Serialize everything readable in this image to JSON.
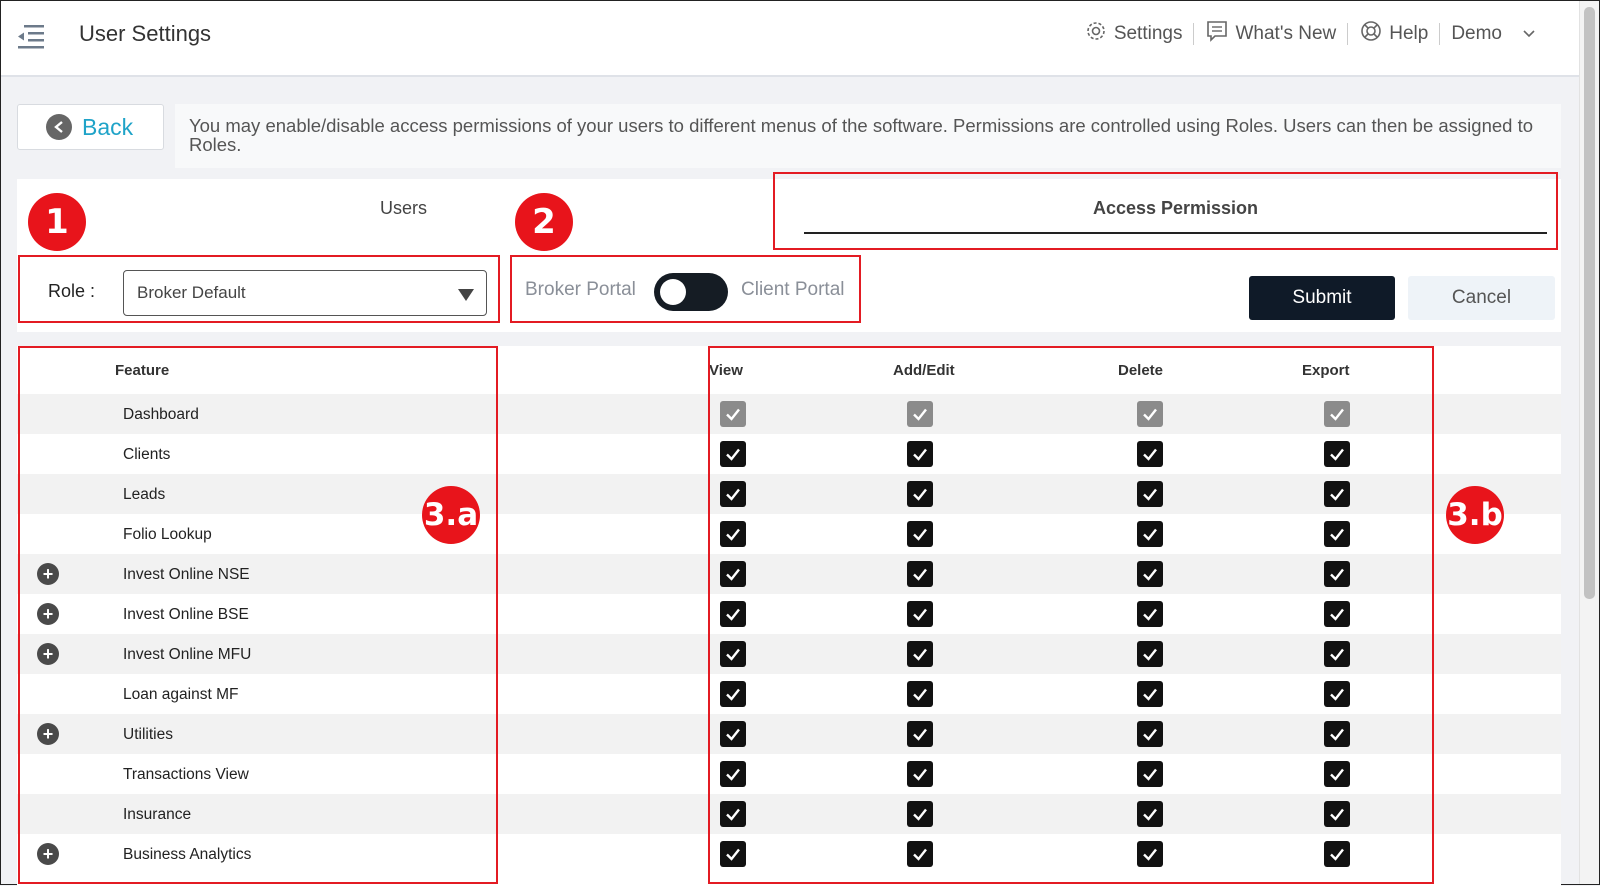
{
  "header": {
    "title": "User Settings",
    "settings_label": "Settings",
    "whats_new_label": "What's New",
    "help_label": "Help",
    "user_label": "Demo"
  },
  "back_label": "Back",
  "info_text": "You may enable/disable access permissions of your users to different menus of the software. Permissions are controlled using Roles. Users can then be assigned to Roles.",
  "tabs": {
    "users": "Users",
    "access": "Access Permission"
  },
  "role": {
    "label": "Role :",
    "value": "Broker Default"
  },
  "portal": {
    "broker": "Broker Portal",
    "client": "Client Portal",
    "client_selected": false
  },
  "buttons": {
    "submit": "Submit",
    "cancel": "Cancel"
  },
  "table": {
    "headers": {
      "feature": "Feature",
      "view": "View",
      "add_edit": "Add/Edit",
      "delete": "Delete",
      "export": "Export"
    },
    "rows": [
      {
        "feature": "Dashboard",
        "expandable": false,
        "disabled": true
      },
      {
        "feature": "Clients",
        "expandable": false,
        "disabled": false
      },
      {
        "feature": "Leads",
        "expandable": false,
        "disabled": false
      },
      {
        "feature": "Folio Lookup",
        "expandable": false,
        "disabled": false
      },
      {
        "feature": "Invest Online NSE",
        "expandable": true,
        "disabled": false
      },
      {
        "feature": "Invest Online BSE",
        "expandable": true,
        "disabled": false
      },
      {
        "feature": "Invest Online MFU",
        "expandable": true,
        "disabled": false
      },
      {
        "feature": "Loan against MF",
        "expandable": false,
        "disabled": false
      },
      {
        "feature": "Utilities",
        "expandable": true,
        "disabled": false
      },
      {
        "feature": "Transactions View",
        "expandable": false,
        "disabled": false
      },
      {
        "feature": "Insurance",
        "expandable": false,
        "disabled": false
      },
      {
        "feature": "Business Analytics",
        "expandable": true,
        "disabled": false
      }
    ]
  },
  "annotations": {
    "role": "1",
    "portal": "2",
    "features": "3.a",
    "permissions": "3.b"
  },
  "colors": {
    "accent": "#1fa3c8",
    "annotation": "#e31b23",
    "submit_bg": "#0f1a28"
  }
}
